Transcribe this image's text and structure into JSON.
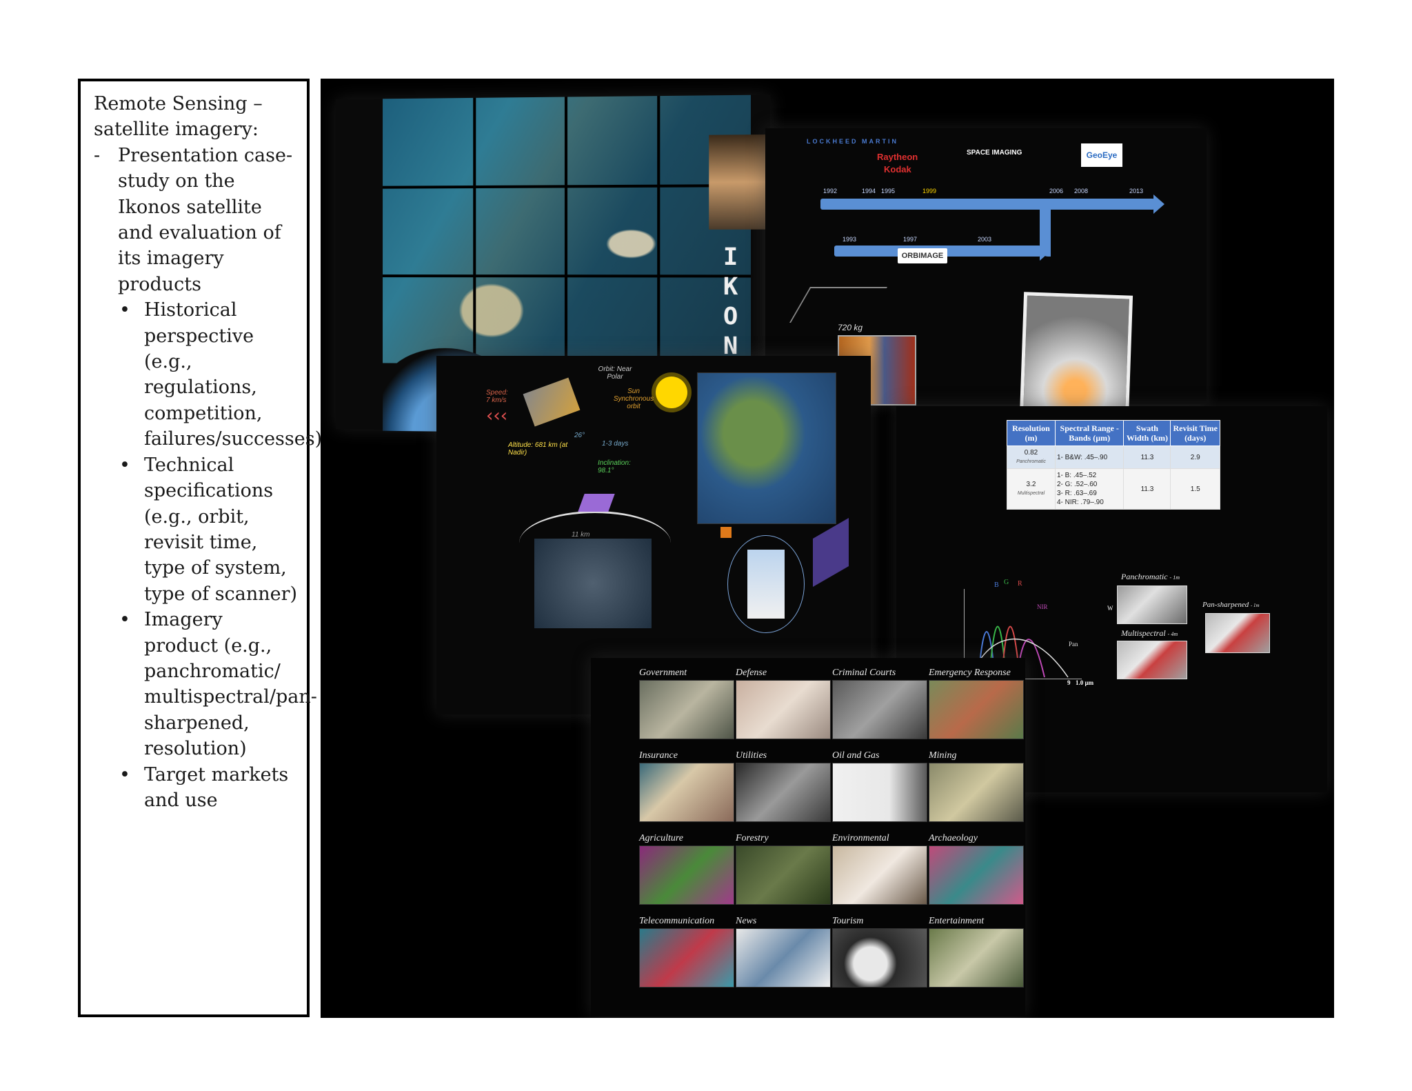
{
  "textbox": {
    "title": "Remote Sensing – satellite imagery:",
    "items": [
      {
        "marker": "-",
        "text": "Presentation case-study on the Ikonos satellite and evaluation of its imagery products",
        "subitems": [
          {
            "marker": "•",
            "text": "Historical perspective (e.g., regulations, competition, failures/successes)"
          },
          {
            "marker": "•",
            "text": "Technical specifications (e.g., orbit, revisit time, type of system, type of scanner)"
          },
          {
            "marker": "•",
            "text": "Imagery product (e.g., panchromatic/ multispectral/pan-sharpened, resolution)"
          },
          {
            "marker": "•",
            "text": "Target markets and use"
          }
        ]
      }
    ]
  },
  "montage": {
    "slide1": {
      "vertical_title": "IKONOS"
    },
    "slide2": {
      "logos": [
        "LOCKHEED MARTIN",
        "Raytheon",
        "Kodak",
        "SPACE IMAGING",
        "GeoEye",
        "ORBIMAGE"
      ],
      "years_top": [
        "1992",
        "1994",
        "1995",
        "1999",
        "2006",
        "2008",
        "2013"
      ],
      "years_bottom": [
        "1993",
        "1997",
        "2003"
      ],
      "mass": "720 kg"
    },
    "slide3": {
      "orbit": "Orbit: Near Polar",
      "speed": "Speed: 7 km/s",
      "sun_orbit": "Sun Synchronous orbit",
      "altitude": "Altitude: 681 km (at Nadir)",
      "inclination": "Inclination: 98.1°",
      "angle": "26°",
      "revisit": "1-3 days",
      "swath": "11 km"
    },
    "slide4": {
      "table": {
        "headers": [
          "Resolution (m)",
          "Spectral Range - Bands (µm)",
          "Swath Width (km)",
          "Revisit Time (days)"
        ],
        "rows": [
          {
            "resolution": "0.82",
            "sub": "Panchromatic",
            "bands": "1- B&W:   .45–.90",
            "swath": "11.3",
            "revisit": "2.9"
          },
          {
            "resolution": "3.2",
            "sub": "Multispectral",
            "bands": "1- B:   .45–.52\n2- G:   .52–.60\n3- R:   .63–.69\n4- NIR:   .79–.90",
            "swath": "11.3",
            "revisit": "1.5"
          }
        ]
      },
      "labels": {
        "pan": "Panchromatic",
        "pan_res": "- 1m",
        "multi": "Multispectral",
        "multi_res": "- 4m",
        "pansharp": "Pan-sharpened",
        "pansharp_res": "- 1m",
        "nir": "NIR",
        "pan_short": "Pan",
        "axis": "1.0 µm",
        "axis_tick": "9",
        "b": "B",
        "g": "G",
        "r": "R",
        "w": "W"
      }
    },
    "slide5": {
      "markets": [
        "Government",
        "Defense",
        "Criminal Courts",
        "Emergency Response",
        "Insurance",
        "Utilities",
        "Oil and Gas",
        "Mining",
        "Agriculture",
        "Forestry",
        "Environmental",
        "Archaeology",
        "Telecommunication",
        "News",
        "Tourism",
        "Entertainment"
      ]
    }
  }
}
